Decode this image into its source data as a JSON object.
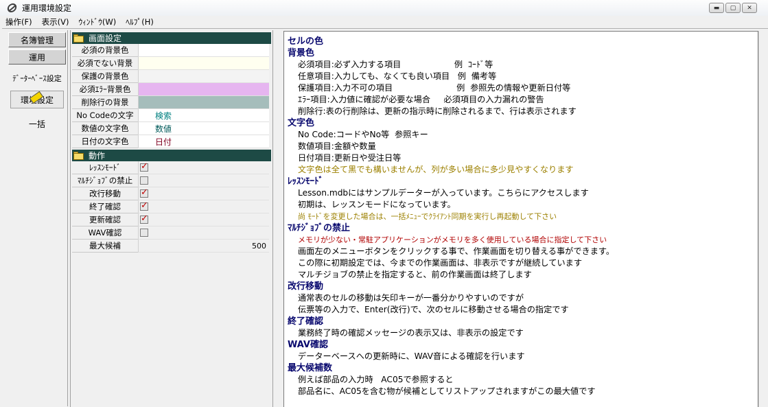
{
  "window": {
    "title": "運用環境設定"
  },
  "window_buttons": {
    "minimize": "▬",
    "maximize": "▢",
    "close": "✕"
  },
  "menu": [
    "操作(F)",
    "表示(V)",
    "ｳｨﾝﾄﾞｳ(W)",
    "ﾍﾙﾌﾟ(H)"
  ],
  "nav": {
    "btn1": "名簿管理",
    "btn2": "運用",
    "label1": "ﾃﾞｰﾀｰﾍﾞｰｽ設定",
    "current": "環境設定",
    "label2": "一括"
  },
  "colors": {
    "required_bg": "#ffffff",
    "optional_bg": "#fffff0",
    "protected_bg": "#f3f3f3",
    "error_bg": "#e6b5f0",
    "deleted_bg": "#a5bdbb",
    "nocode_text": "#008080",
    "number_text": "#005a5a",
    "date_text": "#800020",
    "heading": "#08086e",
    "section_head": "#1d4a45"
  },
  "screen_settings": {
    "header": "画面設定",
    "rows": [
      {
        "label": "必須の背景色",
        "value": ""
      },
      {
        "label": "必須でない背景",
        "value": ""
      },
      {
        "label": "保護の背景色",
        "value": ""
      },
      {
        "label": "必須ｴﾗｰ背景色",
        "value": ""
      },
      {
        "label": "削除行の背景",
        "value": ""
      },
      {
        "label": "No Codeの文字",
        "value": "検索"
      },
      {
        "label": "数値の文字色",
        "value": "数値"
      },
      {
        "label": "日付の文字色",
        "value": "日付"
      }
    ]
  },
  "action_settings": {
    "header": "動作",
    "rows": [
      {
        "label": "ﾚｯｽﾝﾓｰﾄﾞ",
        "checked": true
      },
      {
        "label": "ﾏﾙﾁｼﾞｮﾌﾞの禁止",
        "checked": false
      },
      {
        "label": "改行移動",
        "checked": true
      },
      {
        "label": "終了確認",
        "checked": true
      },
      {
        "label": "更新確認",
        "checked": true
      },
      {
        "label": "WAV確認",
        "checked": false
      }
    ],
    "max_label": "最大候補",
    "max_value": "500"
  },
  "help": {
    "title": "セルの色",
    "bg_heading": "背景色",
    "bg_lines": [
      "必須項目:必ず入力する項目                    例  ｺｰﾄﾞ等",
      "任意項目:入力しても、なくても良い項目   例  備考等",
      "保護項目:入力不可の項目                        例  参照先の情報や更新日付等",
      "ｴﾗｰ項目:入力値に確認が必要な場合     必須項目の入力漏れの警告",
      "削除行:表の行削除は、更新の指示時に削除されるまで、行は表示されます"
    ],
    "text_heading": "文字色",
    "text_lines": [
      "No Code:コードやNo等  参照キー",
      "数値項目:金額や数量",
      "日付項目:更新日や受注日等"
    ],
    "text_note": "文字色は全て黒でも構いませんが、列が多い場合に多少見やすくなります",
    "lesson_heading": "ﾚｯｽﾝﾓｰﾄﾞ",
    "lesson_lines": [
      "Lesson.mdbにはサンプルデーターが入っています。こちらにアクセスします",
      "初期は、レッスンモードになっています。"
    ],
    "lesson_note": "尚 ﾓｰﾄﾞを変更した場合は、一括ﾒﾆｭｰでｸﾗｲｱﾝﾄ同期を実行し再起動して下さい",
    "multi_heading": "ﾏﾙﾁｼﾞｮﾌﾞの禁止",
    "multi_warn": "メモリが少ない・常駐アプリケーションがメモリを多く使用している場合に指定して下さい",
    "multi_lines": [
      "画面左のメニューボタンをクリックする事で、作業画面を切り替える事ができます。",
      "この際に初期設定では、今までの作業画面は、非表示ですが継続しています",
      "マルチジョブの禁止を指定すると、前の作業画面は終了します"
    ],
    "newline_heading": "改行移動",
    "newline_lines": [
      "通常表のセルの移動は矢印キーが一番分かりやすいのですが",
      "伝票等の入力で、Enter(改行)で、次のセルに移動させる場合の指定です"
    ],
    "exit_heading": "終了確認",
    "exit_lines": [
      "業務終了時の確認メッセージの表示又は、非表示の設定です"
    ],
    "wav_heading": "WAV確認",
    "wav_lines": [
      "データーベースへの更新時に、WAV音による確認を行います"
    ],
    "max_heading": "最大候補数",
    "max_lines": [
      "例えば部品の入力時   AC05で参照すると",
      "部品名に、AC05を含む物が候補としてリストアップされますがこの最大値です"
    ]
  }
}
